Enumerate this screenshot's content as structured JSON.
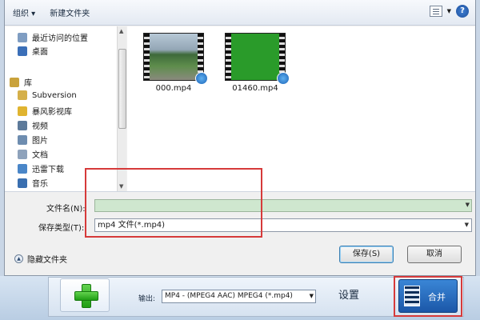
{
  "toolbar": {
    "organize": "组织 ▾",
    "new_folder": "新建文件夹",
    "view_icon": "view-list-icon",
    "help": "?"
  },
  "nav": {
    "items": [
      {
        "label": "最近访问的位置",
        "icon": "recent-places-icon",
        "color": "#7f9dc2"
      },
      {
        "label": "桌面",
        "icon": "desktop-icon",
        "color": "#3b6fb8"
      },
      {
        "label": "库",
        "icon": "library-icon",
        "color": "#c9a23b"
      },
      {
        "label": "Subversion",
        "icon": "folder-icon",
        "color": "#d5b04a"
      },
      {
        "label": "暴风影视库",
        "icon": "media-library-icon",
        "color": "#e0b430"
      },
      {
        "label": "视频",
        "icon": "video-icon",
        "color": "#5d7a9a"
      },
      {
        "label": "图片",
        "icon": "pictures-icon",
        "color": "#6e8db0"
      },
      {
        "label": "文档",
        "icon": "documents-icon",
        "color": "#8ea2bb"
      },
      {
        "label": "迅雷下载",
        "icon": "thunder-download-icon",
        "color": "#4a86c8"
      },
      {
        "label": "音乐",
        "icon": "music-icon",
        "color": "#3a6fb0"
      }
    ]
  },
  "files": [
    {
      "name": "000.mp4",
      "thumb": "road-scene"
    },
    {
      "name": "01460.mp4",
      "thumb": "green-field"
    }
  ],
  "form": {
    "filename_label": "文件名(N):",
    "filename_value": "",
    "filetype_label": "保存类型(T):",
    "filetype_value": "mp4 文件(*.mp4)",
    "hide_folders": "隐藏文件夹",
    "save": "保存(S)",
    "cancel": "取消"
  },
  "app": {
    "output_label": "输出:",
    "output_value": "MP4 - (MPEG4 AAC) MPEG4 (*.mp4)",
    "settings": "设置",
    "merge": "合并"
  },
  "colors": {
    "annotation_red": "#d63a3a",
    "filename_field": "#cfe7cf",
    "merge_button": "#1b57a8"
  }
}
